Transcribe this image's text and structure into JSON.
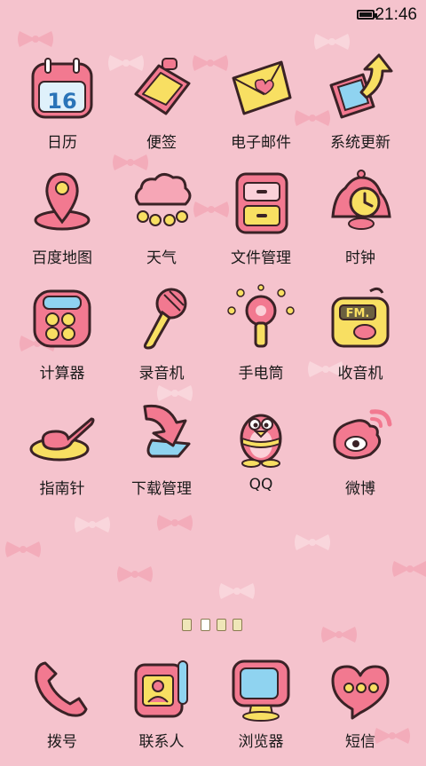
{
  "status_bar": {
    "time": "21:46"
  },
  "apps": [
    {
      "label": "日历",
      "icon": "calendar-icon",
      "date": "16"
    },
    {
      "label": "便签",
      "icon": "notepad-icon"
    },
    {
      "label": "电子邮件",
      "icon": "email-icon"
    },
    {
      "label": "系统更新",
      "icon": "system-update-icon"
    },
    {
      "label": "百度地图",
      "icon": "map-pin-icon"
    },
    {
      "label": "天气",
      "icon": "weather-cloud-icon"
    },
    {
      "label": "文件管理",
      "icon": "file-cabinet-icon"
    },
    {
      "label": "时钟",
      "icon": "alarm-clock-icon"
    },
    {
      "label": "计算器",
      "icon": "calculator-icon"
    },
    {
      "label": "录音机",
      "icon": "microphone-icon"
    },
    {
      "label": "手电筒",
      "icon": "flashlight-bulb-icon"
    },
    {
      "label": "收音机",
      "icon": "radio-icon",
      "radio_text": "FM."
    },
    {
      "label": "指南针",
      "icon": "compass-spoon-icon"
    },
    {
      "label": "下载管理",
      "icon": "download-arrow-icon"
    },
    {
      "label": "QQ",
      "icon": "qq-penguin-icon"
    },
    {
      "label": "微博",
      "icon": "weibo-icon"
    }
  ],
  "pager": {
    "pages": 4,
    "current": 2
  },
  "dock": [
    {
      "label": "拨号",
      "icon": "phone-handset-icon"
    },
    {
      "label": "联系人",
      "icon": "contacts-icon"
    },
    {
      "label": "浏览器",
      "icon": "browser-monitor-icon"
    },
    {
      "label": "短信",
      "icon": "sms-heart-icon"
    }
  ]
}
